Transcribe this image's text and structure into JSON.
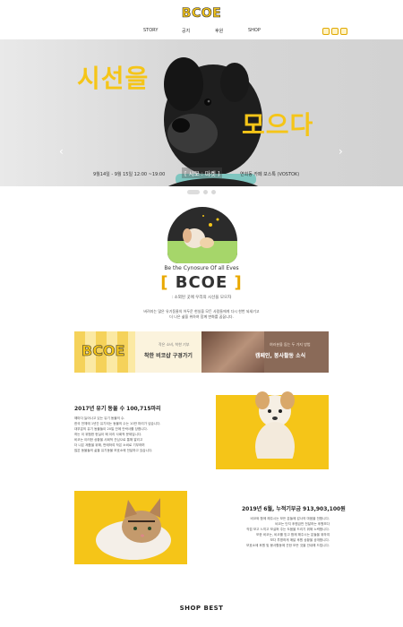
{
  "header": {
    "logo": "BCOE",
    "nav": [
      "STORY",
      "공지",
      "후원",
      "SHOP"
    ],
    "social_icons": [
      "instagram-icon",
      "mail-icon",
      "youtube-icon"
    ]
  },
  "hero": {
    "headline_1": "시선을",
    "headline_2": "모으다",
    "date": "9월14일 - 9월 15일 12:00 ~19:00",
    "tag": "[ 시모 : 마켓 ]",
    "place": "연희동 카페 보스톡 (VOSTOK)",
    "prev_icon": "chevron-left-icon",
    "next_icon": "chevron-right-icon",
    "slide_count": 3,
    "active_slide": 1
  },
  "intro": {
    "tagline": "Be the Cynosure Of all Eves",
    "brand_left": "[",
    "brand": "BCOE",
    "brand_right": "]",
    "brand_sub": ": 소외된 곳에 우리의 시선을 모으자",
    "desc": [
      "버려지는 많은 유기동물의 어두운 현실을 모든 사람들에게 다시 한번 되새기고",
      "더 나은 삶을 위하여 함께 변화를 꿈꿉니다."
    ]
  },
  "cards": {
    "left": {
      "bg_logo": "BCOE",
      "small": "작은 소비, 착한 기부",
      "title": "착한 비코샵 구경가기"
    },
    "right": {
      "small": "여러분을 돕는 두 가지 방법",
      "title": "캠페인, 봉사활동 소식"
    }
  },
  "section1": {
    "title": "2017년 유기 동물 수 100,715마리",
    "lines": [
      "해마다 늘어나고 있는 유기 동물의 수.",
      "한국 전체에 1년간 유기되는 동물의 수는 10만 마리가 넘습니다.",
      "대부분의 유기 동물들이 20일 안에 안락사를 당합니다.",
      "하는 이 위험한 현실이 왜 이리 사회적 문제입니다.",
      "비코는 이러한 상황을 사회적 관심으로 통해 알리고",
      "더 나은 제품을 위해, 판매하여 작은 소비로 기부하며",
      "많은 동물들의 삶을 유기동물 보호소에 전달하고 있습니다."
    ]
  },
  "section2": {
    "title": "2019년 6월, 누적기부금 913,903,100원",
    "lines": [
      "비코와 함께 해주시는 모든 분들께 감사의 마음을 전합니다.",
      "비코는 단지 후원금만 전달하는 후원보다",
      "직접 보고 느끼고 보살펴 주는 도움을 드리기 위해 노력합니다.",
      "또한 비코는, 비코를 믿고 함께 해주시는 분들을 위하여",
      "보다 투명하게 매달 후원 상황을 공개합니다.",
      "보호소에 후원 및 봉사활동에 관한 모든 것을 안내해 드립니다."
    ]
  },
  "shop": {
    "title": "SHOP BEST"
  }
}
